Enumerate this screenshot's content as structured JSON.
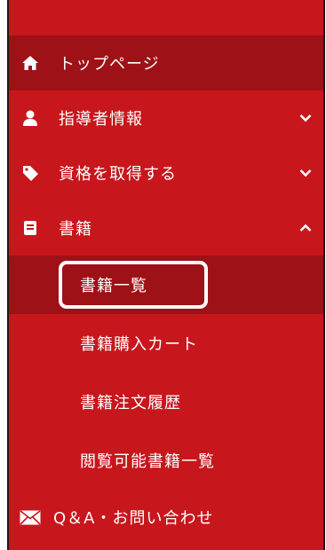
{
  "menu": {
    "items": [
      {
        "label": "トップページ",
        "icon": "home-icon"
      },
      {
        "label": "指導者情報",
        "icon": "user-icon",
        "chevron": "chevron-down-icon"
      },
      {
        "label": "資格を取得する",
        "icon": "tag-icon",
        "chevron": "chevron-down-icon"
      },
      {
        "label": "書籍",
        "icon": "book-icon",
        "chevron": "chevron-up-icon"
      }
    ],
    "books_submenu": [
      {
        "label": "書籍一覧"
      },
      {
        "label": "書籍購入カート"
      },
      {
        "label": "書籍注文履歴"
      },
      {
        "label": "閲覧可能書籍一覧"
      }
    ],
    "qa": {
      "label": "Q＆A・お問い合わせ",
      "icon": "envelope-icon"
    }
  },
  "colors": {
    "menu_bg": "#c8161d",
    "active_bg": "#9e1116",
    "text": "#ffffff",
    "highlight_border": "#ffffff"
  }
}
